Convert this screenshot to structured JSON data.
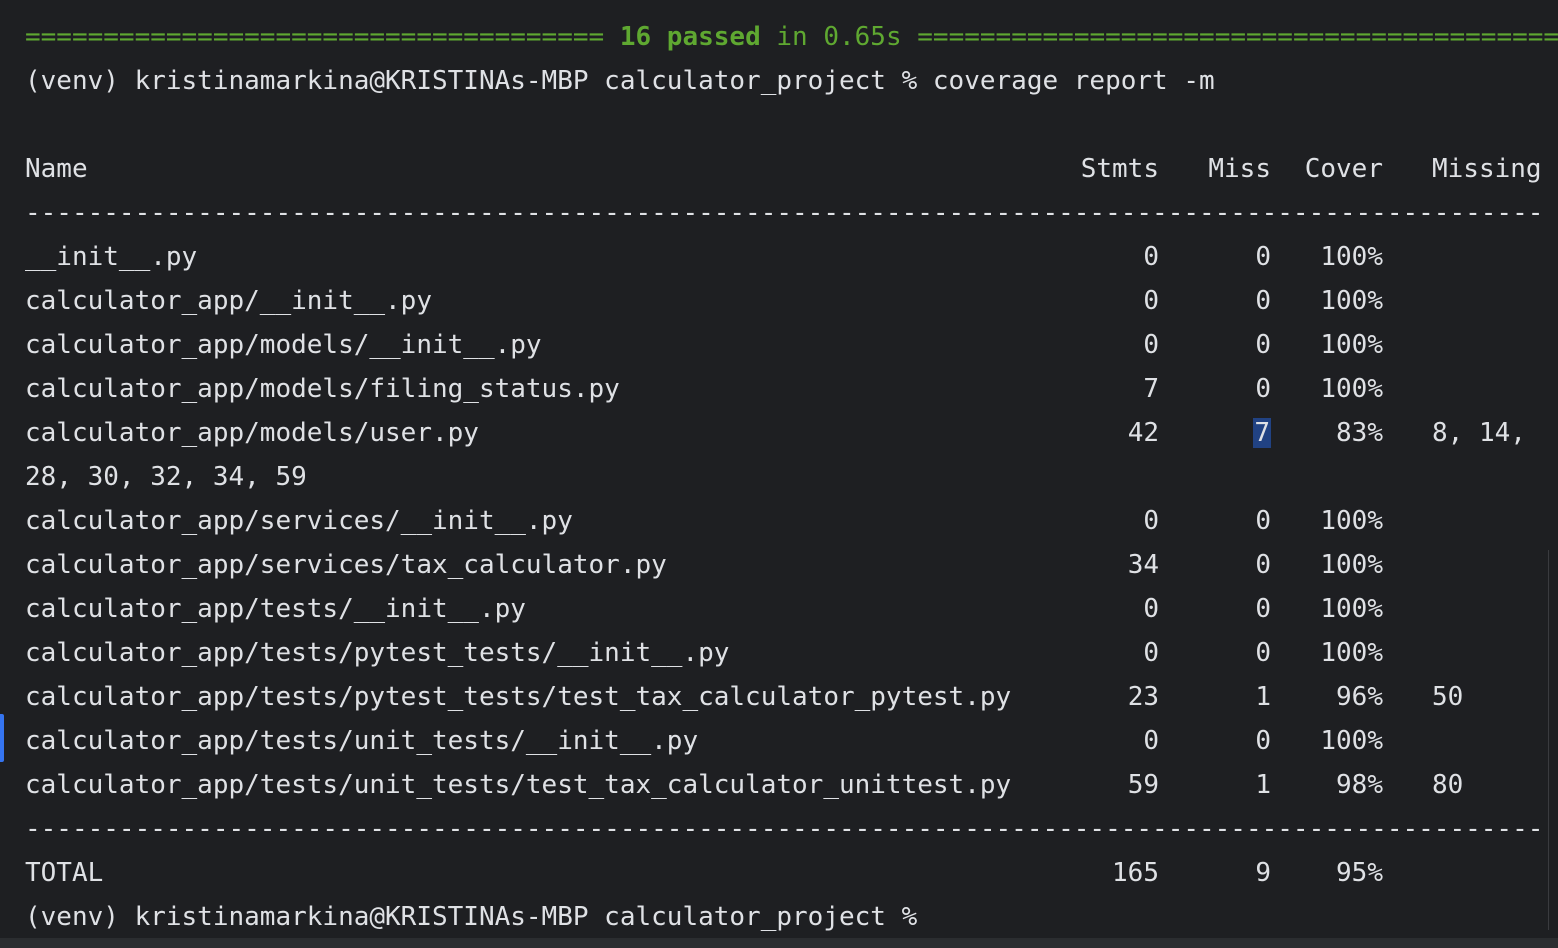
{
  "summary": {
    "left_rule": "=====================================",
    "count_passed": "16 passed",
    "in_time": " in 0.65s ",
    "right_rule": "=========================================="
  },
  "prompt_command": "(venv) kristinamarkina@KRISTINAs-MBP calculator_project % coverage report -m",
  "header": {
    "name": "Name",
    "stmts": "Stmts",
    "miss": "Miss",
    "cover": "Cover",
    "missing": "Missing"
  },
  "separator": "----------------------------------------------------------------------------------------------------------------------------------------------------------------------------------------",
  "rows": [
    {
      "name": "__init__.py",
      "stmts": "0",
      "miss": "0",
      "cover": "100%",
      "missing": ""
    },
    {
      "name": "calculator_app/__init__.py",
      "stmts": "0",
      "miss": "0",
      "cover": "100%",
      "missing": ""
    },
    {
      "name": "calculator_app/models/__init__.py",
      "stmts": "0",
      "miss": "0",
      "cover": "100%",
      "missing": ""
    },
    {
      "name": "calculator_app/models/filing_status.py",
      "stmts": "7",
      "miss": "0",
      "cover": "100%",
      "missing": ""
    },
    {
      "name": "calculator_app/models/user.py",
      "stmts": "42",
      "miss": "7",
      "cover": "83%",
      "missing": "8, 14,"
    },
    {
      "name": "calculator_app/services/__init__.py",
      "stmts": "0",
      "miss": "0",
      "cover": "100%",
      "missing": ""
    },
    {
      "name": "calculator_app/services/tax_calculator.py",
      "stmts": "34",
      "miss": "0",
      "cover": "100%",
      "missing": ""
    },
    {
      "name": "calculator_app/tests/__init__.py",
      "stmts": "0",
      "miss": "0",
      "cover": "100%",
      "missing": ""
    },
    {
      "name": "calculator_app/tests/pytest_tests/__init__.py",
      "stmts": "0",
      "miss": "0",
      "cover": "100%",
      "missing": ""
    },
    {
      "name": "calculator_app/tests/pytest_tests/test_tax_calculator_pytest.py",
      "stmts": "23",
      "miss": "1",
      "cover": "96%",
      "missing": "50"
    },
    {
      "name": "calculator_app/tests/unit_tests/__init__.py",
      "stmts": "0",
      "miss": "0",
      "cover": "100%",
      "missing": ""
    },
    {
      "name": "calculator_app/tests/unit_tests/test_tax_calculator_unittest.py",
      "stmts": "59",
      "miss": "1",
      "cover": "98%",
      "missing": "80"
    }
  ],
  "wrapped_missing": "28, 30, 32, 34, 59",
  "total": {
    "name": "TOTAL",
    "stmts": "165",
    "miss": "9",
    "cover": "95%"
  },
  "final_prompt": "(venv) kristinamarkina@KRISTINAs-MBP calculator_project %",
  "colors": {
    "background": "#1e1f22",
    "text": "#dfe1e5",
    "pass_green": "#5fa831",
    "selection": "#214283",
    "gutter_marker": "#3574f0"
  }
}
